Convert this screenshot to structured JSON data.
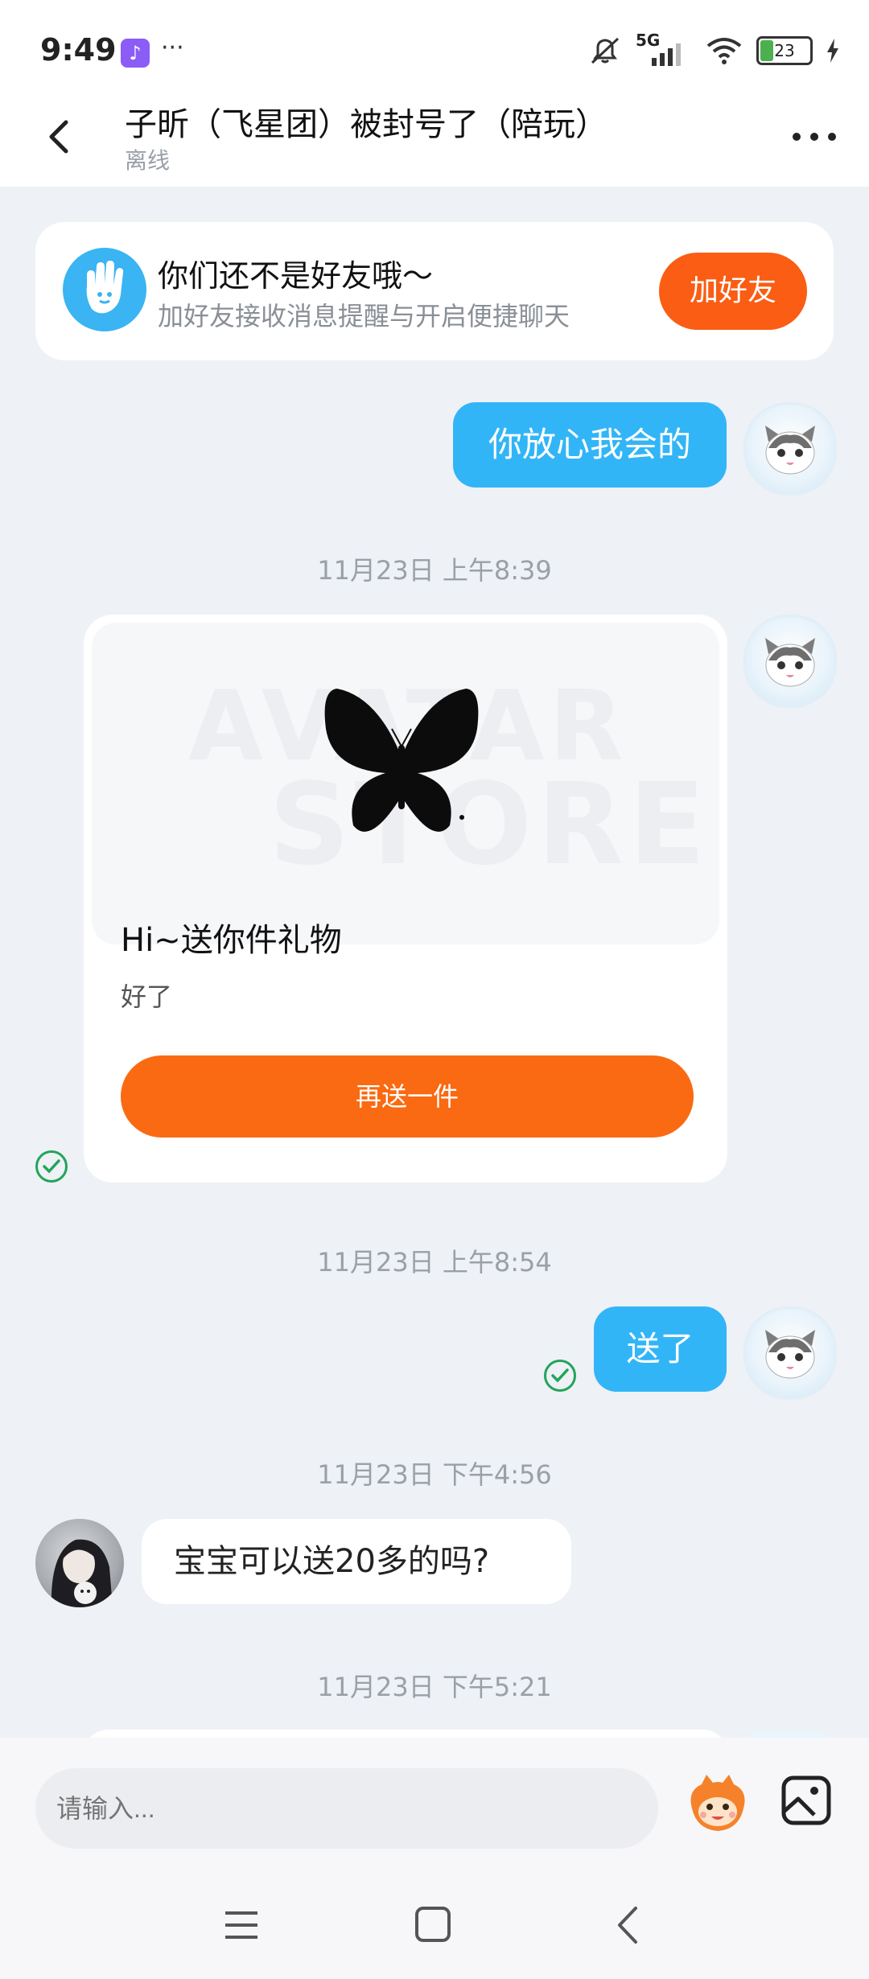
{
  "status_bar": {
    "time": "9:49",
    "app_icon": "tiktok-icon",
    "more_dots": "···",
    "network": "5G",
    "battery": "23"
  },
  "header": {
    "title": "子昕（飞星团）被封号了（陪玩）",
    "subtitle": "离线"
  },
  "friend_banner": {
    "title": "你们还不是好友哦～",
    "subtitle": "加好友接收消息提醒与开启便捷聊天",
    "button": "加好友"
  },
  "messages": [
    {
      "type": "text",
      "from": "me",
      "text": "你放心我会的"
    },
    {
      "type": "timestamp",
      "text": "11月23日 上午8:39"
    },
    {
      "type": "gift",
      "from": "me",
      "title": "Hi~送你件礼物",
      "message": "好了",
      "button": "再送一件",
      "watermark_line1": "AVATAR",
      "watermark_line2": "STORE"
    },
    {
      "type": "timestamp",
      "text": "11月23日 上午8:54"
    },
    {
      "type": "text",
      "from": "me",
      "text": "送了"
    },
    {
      "type": "timestamp",
      "text": "11月23日 下午4:56"
    },
    {
      "type": "text",
      "from": "other",
      "text": "宝宝可以送20多的吗?"
    },
    {
      "type": "timestamp",
      "text": "11月23日 下午5:21"
    }
  ],
  "input": {
    "placeholder": "请输入..."
  },
  "colors": {
    "accent_orange": "#fa5d13",
    "bubble_blue": "#32b5f7",
    "read_check": "#22a45a"
  }
}
